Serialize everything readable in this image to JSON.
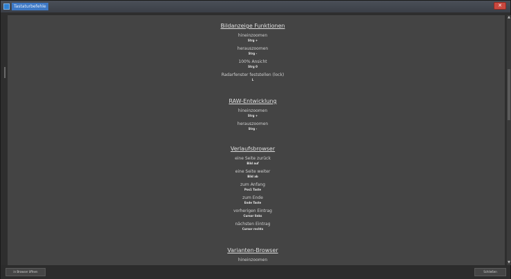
{
  "window": {
    "title": "Tastaturbefehle",
    "close_glyph": "✕"
  },
  "sections": [
    {
      "heading": "Bildanzeige Funktionen",
      "entries": [
        {
          "label": "hineinzoomen",
          "key": "Strg +"
        },
        {
          "label": "herauszoomen",
          "key": "Strg -"
        },
        {
          "label": "100% Ansicht",
          "key": "Strg 0"
        },
        {
          "label": "Radarfenster feststellen (lock)",
          "key": "L"
        }
      ]
    },
    {
      "heading": "RAW-Entwicklung",
      "entries": [
        {
          "label": "hineinzoomen",
          "key": "Strg +"
        },
        {
          "label": "herauszoomen",
          "key": "Strg -"
        }
      ]
    },
    {
      "heading": "Verlaufsbrowser",
      "entries": [
        {
          "label": "eine Seite zurück",
          "key": "Bild auf"
        },
        {
          "label": "eine Seite weiter",
          "key": "Bild ab"
        },
        {
          "label": "zum Anfang",
          "key": "Pos1 Taste"
        },
        {
          "label": "zum Ende",
          "key": "Ende Taste"
        },
        {
          "label": "vorherigen Eintrag",
          "key": "Cursor links"
        },
        {
          "label": "nächsten Eintrag",
          "key": "Cursor rechts"
        }
      ]
    },
    {
      "heading": "Varianten-Browser",
      "entries": [
        {
          "label": "hineinzoomen",
          "key": ""
        }
      ]
    }
  ],
  "scrollbar": {
    "up_glyph": "▲",
    "down_glyph": "▼"
  },
  "footer": {
    "browser_button": "in Browser öffnen",
    "close_button": "Schließen"
  }
}
